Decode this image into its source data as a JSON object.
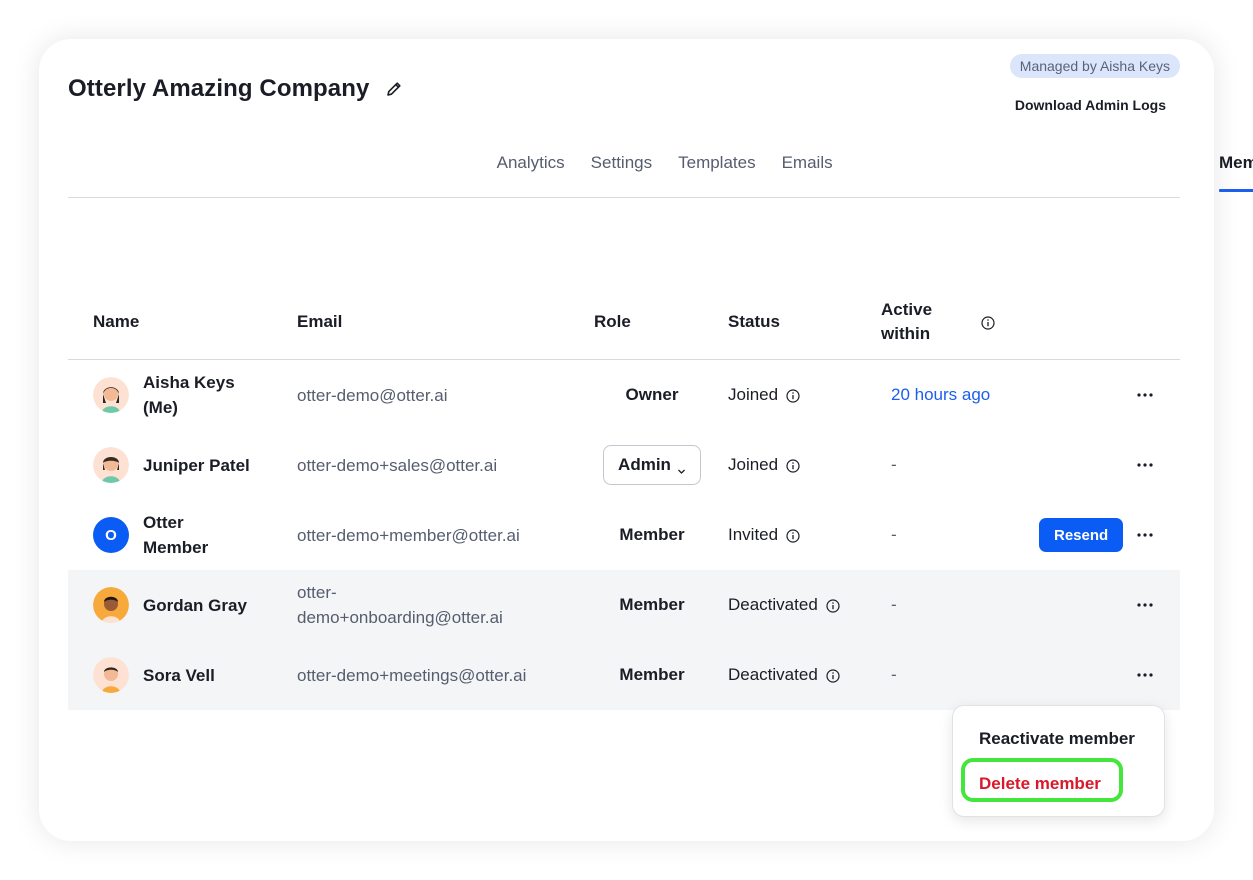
{
  "header": {
    "company_name": "Otterly Amazing Company",
    "managed_badge": "Managed by Aisha Keys",
    "download_logs": "Download Admin Logs"
  },
  "tabs": [
    {
      "label": "Members",
      "active": true
    },
    {
      "label": "Analytics",
      "active": false
    },
    {
      "label": "Settings",
      "active": false
    },
    {
      "label": "Templates",
      "active": false
    },
    {
      "label": "Emails",
      "active": false
    }
  ],
  "table": {
    "columns": {
      "name": "Name",
      "email": "Email",
      "role": "Role",
      "status": "Status",
      "active_within_line1": "Active",
      "active_within_line2": "within"
    },
    "rows": [
      {
        "name_line1": "Aisha Keys",
        "name_line2": "(Me)",
        "email": "otter-demo@otter.ai",
        "role": "Owner",
        "status": "Joined",
        "active": "20 hours ago"
      },
      {
        "name_line1": "Juniper Patel",
        "name_line2": "",
        "email": "otter-demo+sales@otter.ai",
        "role": "Admin",
        "status": "Joined",
        "active": "-"
      },
      {
        "name_line1": "Otter",
        "name_line2": "Member",
        "avatar_letter": "O",
        "email": "otter-demo+member@otter.ai",
        "role": "Member",
        "status": "Invited",
        "active": "-",
        "action": "Resend"
      },
      {
        "name_line1": "Gordan Gray",
        "name_line2": "",
        "email_line1": "otter-",
        "email_line2": "demo+onboarding@otter.ai",
        "role": "Member",
        "status": "Deactivated",
        "active": "-"
      },
      {
        "name_line1": "Sora Vell",
        "name_line2": "",
        "email": "otter-demo+meetings@otter.ai",
        "role": "Member",
        "status": "Deactivated",
        "active": "-"
      }
    ]
  },
  "context_menu": {
    "reactivate": "Reactivate member",
    "delete": "Delete member"
  },
  "colors": {
    "accent": "#1b5ef0",
    "danger": "#d7192a",
    "highlight": "#44e63c",
    "badge_bg": "#dbe5fb"
  },
  "icons": [
    "pencil-icon",
    "info-icon",
    "chevron-down-icon",
    "more-horizontal-icon"
  ]
}
